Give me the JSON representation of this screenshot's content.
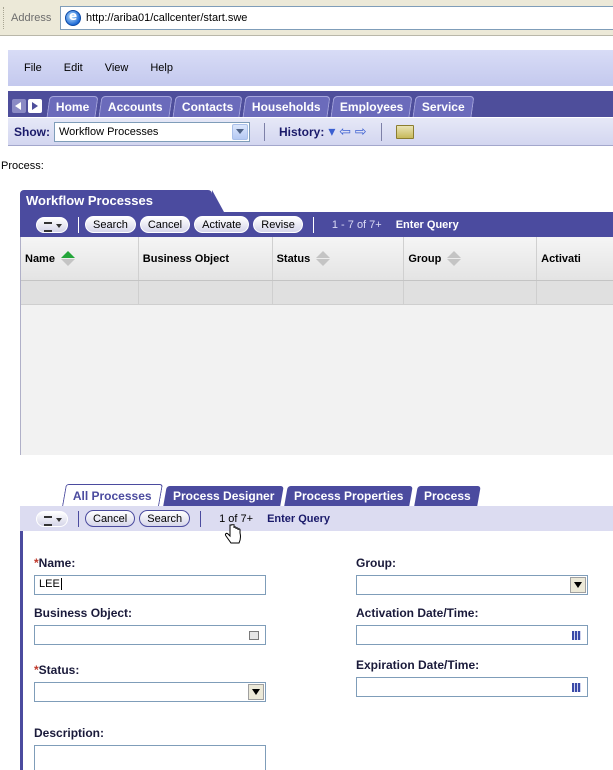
{
  "browser": {
    "address_label": "Address",
    "url": "http://ariba01/callcenter/start.swe"
  },
  "menu": [
    "File",
    "Edit",
    "View",
    "Help"
  ],
  "main_tabs": [
    "Home",
    "Accounts",
    "Contacts",
    "Households",
    "Employees",
    "Service"
  ],
  "show_bar": {
    "show_label": "Show:",
    "show_value": "Workflow Processes",
    "history_label": "History:"
  },
  "process_label": "Process:",
  "workflow_applet": {
    "title": "Workflow Processes",
    "buttons": [
      "Search",
      "Cancel",
      "Activate",
      "Revise"
    ],
    "record_count": "1 - 7 of 7+",
    "mode": "Enter Query",
    "columns": [
      "Name",
      "Business Object",
      "Status",
      "Group",
      "Activati"
    ]
  },
  "view_tabs": [
    "All Processes",
    "Process Designer",
    "Process Properties",
    "Process"
  ],
  "form_applet": {
    "buttons": [
      "Cancel",
      "Search"
    ],
    "record_count": "1 of 7+",
    "mode": "Enter Query",
    "fields": {
      "name_label": "Name:",
      "name_value": "LEE",
      "group_label": "Group:",
      "business_object_label": "Business Object:",
      "activation_label": "Activation Date/Time:",
      "status_label": "Status:",
      "expiration_label": "Expiration Date/Time:",
      "description_label": "Description:"
    },
    "required_marker": "*"
  }
}
